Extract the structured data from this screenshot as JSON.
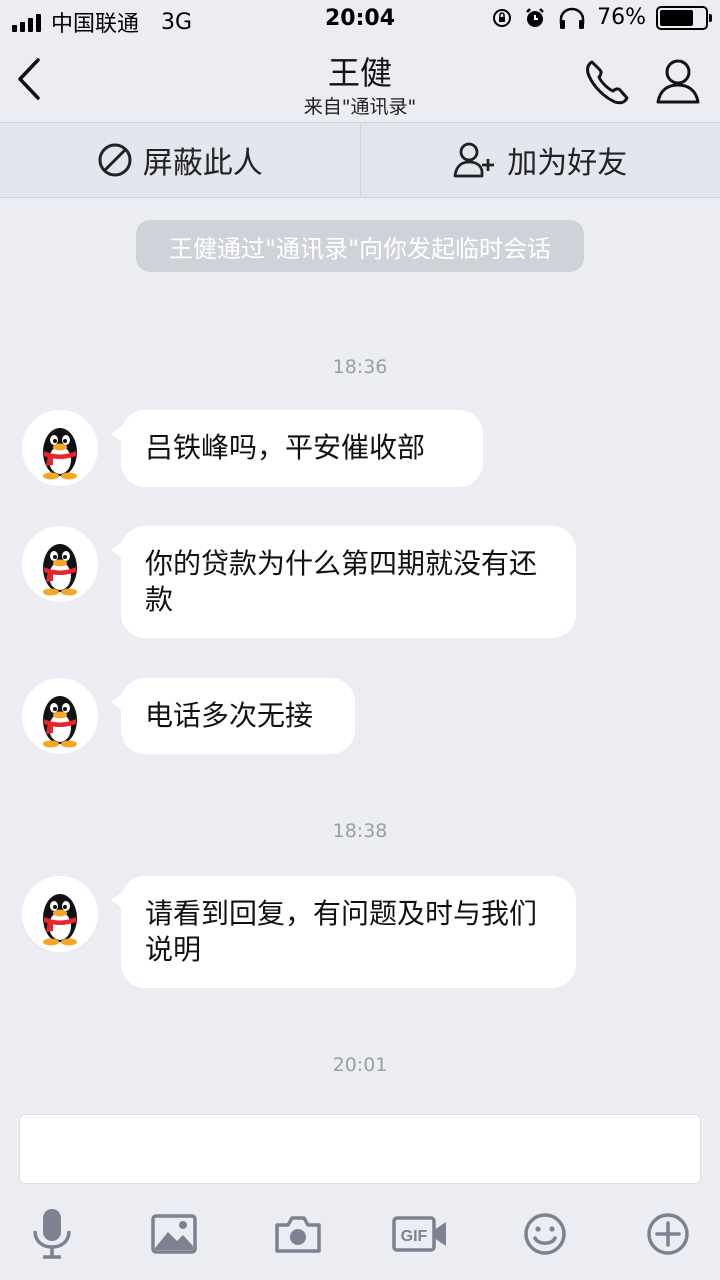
{
  "status_bar": {
    "carrier": "中国联通",
    "network": "3G",
    "time": "20:04",
    "battery": "76%",
    "battery_level": 0.76
  },
  "header": {
    "title": "王健",
    "subtitle": "来自\"通讯录\""
  },
  "actions": {
    "block_label": "屏蔽此人",
    "add_friend_label": "加为好友"
  },
  "system_notice": "王健通过\"通讯录\"向你发起临时会话",
  "timestamps": [
    "18:36",
    "18:38",
    "20:01"
  ],
  "messages": [
    {
      "text": "吕铁峰吗，平安催收部"
    },
    {
      "text": "你的贷款为什么第四期就没有还款"
    },
    {
      "text": "电话多次无接"
    },
    {
      "text": "请看到回复，有问题及时与我们说明"
    }
  ],
  "toolbar": [
    "microphone-icon",
    "image-icon",
    "camera-icon",
    "gif-icon",
    "emoji-icon",
    "plus-icon"
  ],
  "colors": {
    "background": "#ebedf2",
    "bubble": "#ffffff",
    "action_bar": "#e3e6ef",
    "icon": "#7d8190",
    "penguin_scarf": "#e8252b",
    "penguin_feet": "#f5a623"
  }
}
